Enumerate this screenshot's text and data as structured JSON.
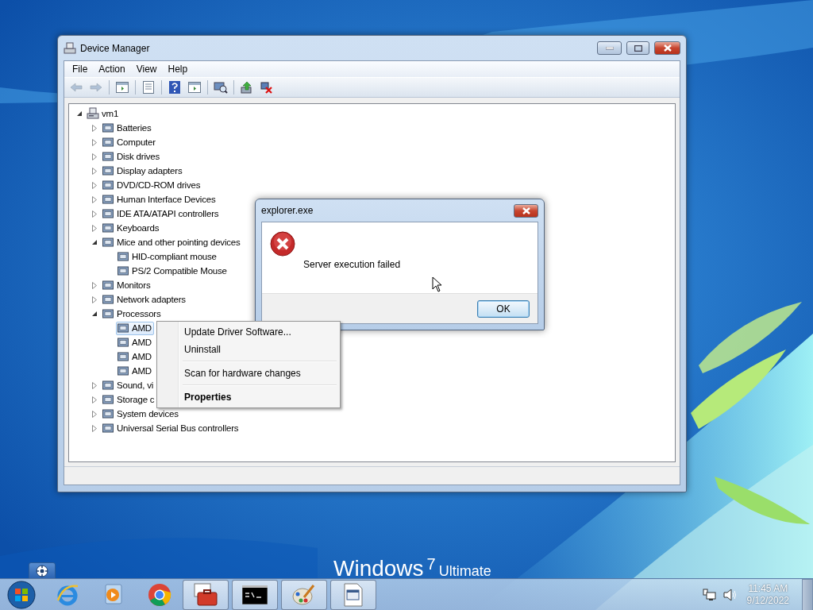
{
  "desktop": {
    "branding": [
      "Windows",
      "7",
      "Ultimate"
    ]
  },
  "device_manager": {
    "title": "Device Manager",
    "menu": [
      "File",
      "Action",
      "View",
      "Help"
    ],
    "toolbar": [
      {
        "kind": "back",
        "disabled": true
      },
      {
        "kind": "forward",
        "disabled": true
      },
      {
        "kind": "pane",
        "disabled": false
      },
      {
        "kind": "properties",
        "disabled": false
      },
      {
        "kind": "help",
        "disabled": false
      },
      {
        "kind": "pane",
        "disabled": false
      },
      {
        "kind": "scan",
        "disabled": false
      },
      {
        "kind": "update",
        "disabled": false
      },
      {
        "kind": "uninstall",
        "disabled": false
      }
    ],
    "tree": {
      "label": "vm1",
      "expanded": true,
      "selected": false,
      "children": [
        {
          "label": "Batteries",
          "expanded": false,
          "selected": false
        },
        {
          "label": "Computer",
          "expanded": false,
          "selected": false
        },
        {
          "label": "Disk drives",
          "expanded": false,
          "selected": false
        },
        {
          "label": "Display adapters",
          "expanded": false,
          "selected": false
        },
        {
          "label": "DVD/CD-ROM drives",
          "expanded": false,
          "selected": false
        },
        {
          "label": "Human Interface Devices",
          "expanded": false,
          "selected": false
        },
        {
          "label": "IDE ATA/ATAPI controllers",
          "expanded": false,
          "selected": false
        },
        {
          "label": "Keyboards",
          "expanded": false,
          "selected": false
        },
        {
          "label": "Mice and other pointing devices",
          "expanded": true,
          "selected": false,
          "children": [
            {
              "label": "HID-compliant mouse",
              "selected": false
            },
            {
              "label": "PS/2 Compatible Mouse",
              "selected": false
            }
          ]
        },
        {
          "label": "Monitors",
          "expanded": false,
          "selected": false
        },
        {
          "label": "Network adapters",
          "expanded": false,
          "selected": false
        },
        {
          "label": "Processors",
          "expanded": true,
          "selected": false,
          "children": [
            {
              "label": "AMD",
              "selected": true
            },
            {
              "label": "AMD",
              "selected": false
            },
            {
              "label": "AMD",
              "selected": false
            },
            {
              "label": "AMD",
              "selected": false
            }
          ]
        },
        {
          "label": "Sound, vi",
          "expanded": false,
          "selected": false
        },
        {
          "label": "Storage c",
          "expanded": false,
          "selected": false
        },
        {
          "label": "System devices",
          "expanded": false,
          "selected": false
        },
        {
          "label": "Universal Serial Bus controllers",
          "expanded": false,
          "selected": false
        }
      ]
    }
  },
  "dialog": {
    "title": "explorer.exe",
    "message": "Server execution failed",
    "button": "OK"
  },
  "context_menu": {
    "groups": [
      [
        {
          "label": "Update Driver Software...",
          "kind": "normal"
        },
        {
          "label": "Uninstall",
          "kind": "normal"
        }
      ],
      [
        {
          "label": "Scan for hardware changes",
          "kind": "normal"
        }
      ],
      [
        {
          "label": "Properties",
          "kind": "default"
        }
      ]
    ]
  },
  "taskbar": {
    "items": [
      {
        "kind": "browser",
        "running": false
      },
      {
        "kind": "media",
        "running": false
      },
      {
        "kind": "chrome",
        "running": false
      },
      {
        "kind": "toolbox",
        "running": true
      },
      {
        "kind": "console",
        "running": true
      },
      {
        "kind": "paint",
        "running": true
      },
      {
        "kind": "document",
        "running": true
      }
    ],
    "clock": {
      "time": "11:45 AM",
      "date": "9/12/2022"
    }
  }
}
